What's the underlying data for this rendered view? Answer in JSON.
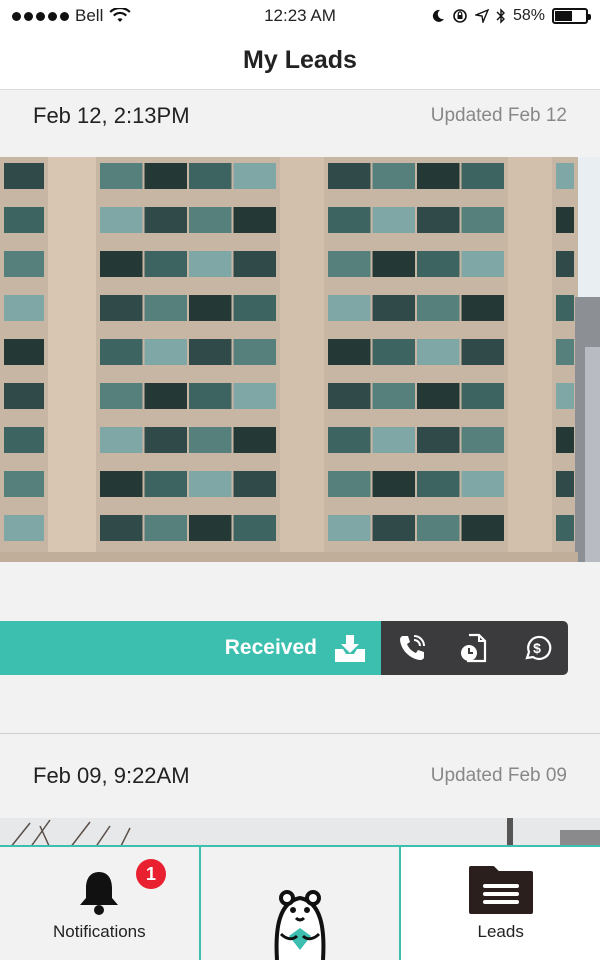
{
  "status_bar": {
    "carrier": "Bell",
    "time": "12:23 AM",
    "battery_percent": "58%",
    "battery_level": 0.58
  },
  "nav": {
    "title": "My Leads"
  },
  "leads": [
    {
      "date": "Feb 12, 2:13PM",
      "updated": "Updated Feb 12",
      "status": "Received"
    },
    {
      "date": "Feb 09, 9:22AM",
      "updated": "Updated Feb 09"
    }
  ],
  "actions": {
    "icons": [
      "phone-call-icon",
      "document-clock-icon",
      "dollar-icon"
    ]
  },
  "tabs": [
    {
      "label": "Notifications",
      "badge": "1",
      "icon": "bell-icon"
    },
    {
      "label": "",
      "icon": "gopher-logo"
    },
    {
      "label": "Leads",
      "icon": "folder-icon"
    }
  ],
  "colors": {
    "accent": "#3dbfb0",
    "dark": "#3b3b3d",
    "badge": "#e8202f"
  }
}
